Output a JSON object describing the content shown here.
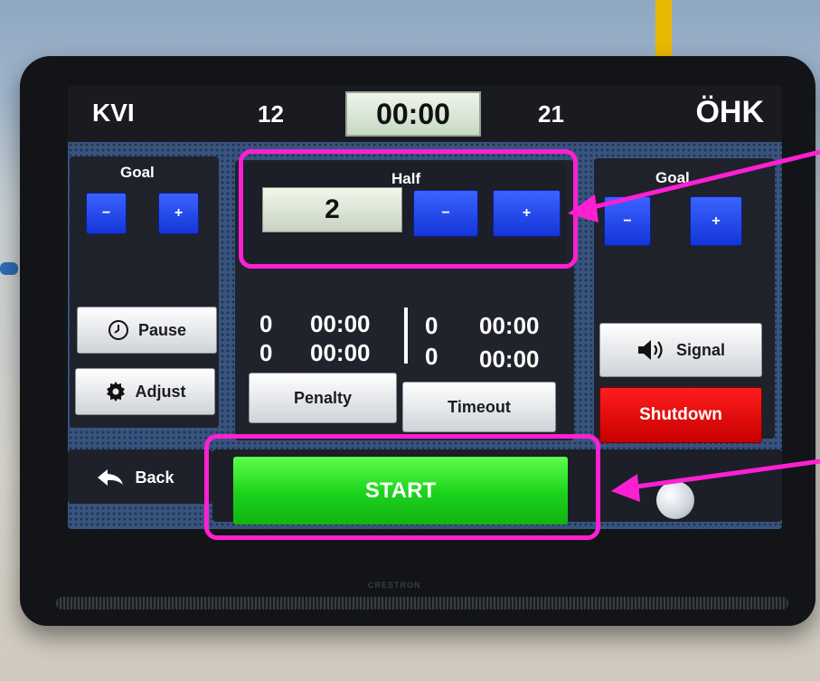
{
  "scoreboard": {
    "home_team": "KVI",
    "away_team": "ÖHK",
    "home_score": "12",
    "away_score": "21",
    "clock": "00:00"
  },
  "left_panel": {
    "title": "Goal",
    "minus": "−",
    "plus": "+",
    "pause_label": "Pause",
    "adjust_label": "Adjust"
  },
  "center_panel": {
    "half_title": "Half",
    "half_value": "2",
    "minus": "−",
    "plus": "+",
    "penalties": {
      "home": [
        {
          "count": "0",
          "time": "00:00"
        },
        {
          "count": "0",
          "time": "00:00"
        }
      ],
      "away": [
        {
          "count": "0",
          "time": "00:00"
        },
        {
          "count": "0",
          "time": "00:00"
        }
      ]
    },
    "penalty_label": "Penalty",
    "timeout_label": "Timeout"
  },
  "right_panel": {
    "title": "Goal",
    "minus": "−",
    "plus": "+",
    "signal_label": "Signal",
    "shutdown_label": "Shutdown"
  },
  "bottom": {
    "back_label": "Back",
    "start_label": "START"
  },
  "colors": {
    "highlight": "#ff1fd3",
    "blue_button": "#2448f0",
    "start_green": "#22d822",
    "shutdown_red": "#e60000"
  },
  "icons": [
    "clock-icon",
    "gear-icon",
    "speaker-icon",
    "back-arrow-icon",
    "ball-icon"
  ]
}
